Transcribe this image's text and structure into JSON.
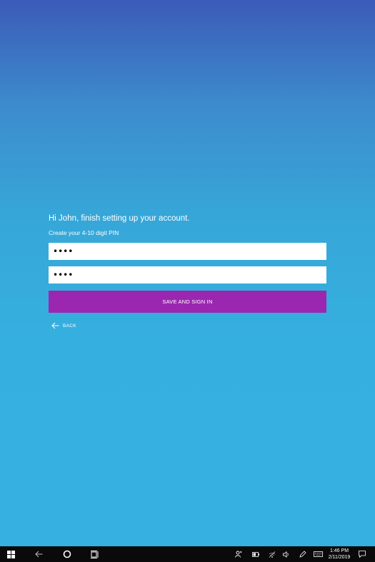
{
  "setup": {
    "greeting": "Hi John, finish setting up your account.",
    "pin_prompt": "Create your 4-10 digit PIN",
    "pin_value": "••••",
    "confirm_pin_value": "••••",
    "save_label": "SAVE AND SIGN IN",
    "back_label": "BACK"
  },
  "colors": {
    "background_top": "#3b5bb8",
    "background_bottom": "#35b0e0",
    "button": "#9b27b0",
    "taskbar": "#0a0a0a"
  },
  "taskbar": {
    "time": "1:46 PM",
    "date": "2/11/2019",
    "icons": [
      "windows-start-icon",
      "back-arrow-icon",
      "cortana-circle-icon",
      "task-view-icon",
      "people-icon",
      "battery-icon",
      "wifi-icon",
      "volume-icon",
      "pen-icon",
      "keyboard-icon",
      "notifications-icon"
    ]
  }
}
